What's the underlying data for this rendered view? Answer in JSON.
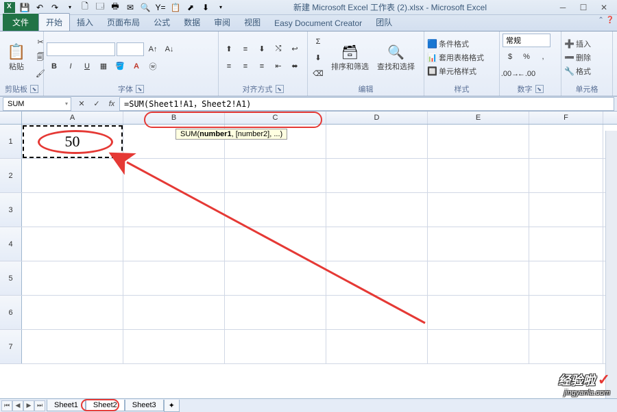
{
  "titlebar": {
    "filename": "新建 Microsoft Excel 工作表 (2).xlsx",
    "app": "Microsoft Excel"
  },
  "tabs": {
    "file": "文件",
    "home": "开始",
    "insert": "插入",
    "layout": "页面布局",
    "formulas": "公式",
    "data": "数据",
    "review": "审阅",
    "view": "视图",
    "edc": "Easy Document Creator",
    "team": "团队"
  },
  "ribbon": {
    "clipboard": {
      "label": "剪贴板",
      "paste": "粘贴"
    },
    "font": {
      "label": "字体"
    },
    "align": {
      "label": "对齐方式"
    },
    "edit": {
      "label": "编辑",
      "sort": "排序和筛选",
      "find": "查找和选择"
    },
    "styles": {
      "label": "样式",
      "cond": "条件格式",
      "table": "套用表格格式",
      "cell": "单元格样式"
    },
    "number": {
      "label": "数字",
      "general": "常规"
    },
    "cells": {
      "label": "单元格",
      "insert": "插入",
      "delete": "删除",
      "format": "格式"
    }
  },
  "formula_bar": {
    "name_box": "SUM",
    "formula": "=SUM(Sheet1!A1，Sheet2!A1)",
    "tooltip_prefix": "SUM(",
    "tooltip_bold": "number1",
    "tooltip_rest": ", [number2], ...)"
  },
  "columns": [
    "A",
    "B",
    "C",
    "D",
    "E",
    "F"
  ],
  "rows": [
    "1",
    "2",
    "3",
    "4",
    "5",
    "6",
    "7"
  ],
  "cells": {
    "A1": "50"
  },
  "sheets": {
    "s1": "Sheet1",
    "s2": "Sheet2",
    "s3": "Sheet3",
    "active": "Sheet2"
  },
  "watermark": {
    "main": "经验啦",
    "sub": "jingyanla.com"
  }
}
